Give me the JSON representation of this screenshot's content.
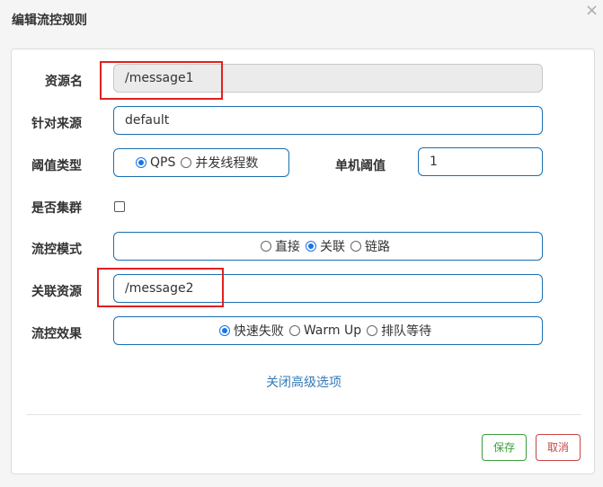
{
  "dialog": {
    "title": "编辑流控规则",
    "close_glyph": "×"
  },
  "form": {
    "resource_name": {
      "label": "资源名",
      "value": "/message1"
    },
    "limit_app": {
      "label": "针对来源",
      "value": "default"
    },
    "threshold_type": {
      "label": "阈值类型",
      "options": [
        "QPS",
        "并发线程数"
      ],
      "selected": "QPS"
    },
    "single_threshold": {
      "label": "单机阈值",
      "value": "1"
    },
    "cluster": {
      "label": "是否集群",
      "checked": false
    },
    "strategy": {
      "label": "流控模式",
      "options": [
        "直接",
        "关联",
        "链路"
      ],
      "selected": "关联"
    },
    "ref_resource": {
      "label": "关联资源",
      "value": "/message2"
    },
    "control_behavior": {
      "label": "流控效果",
      "options": [
        "快速失败",
        "Warm Up",
        "排队等待"
      ],
      "selected": "快速失败"
    },
    "advanced_toggle": "关闭高级选项"
  },
  "footer": {
    "save_label": "保存",
    "cancel_label": "取消"
  },
  "colors": {
    "input_border": "#1a6fb0",
    "highlight": "#e02020",
    "save": "#3c9c3c",
    "cancel": "#c94444",
    "link": "#337ab7"
  }
}
